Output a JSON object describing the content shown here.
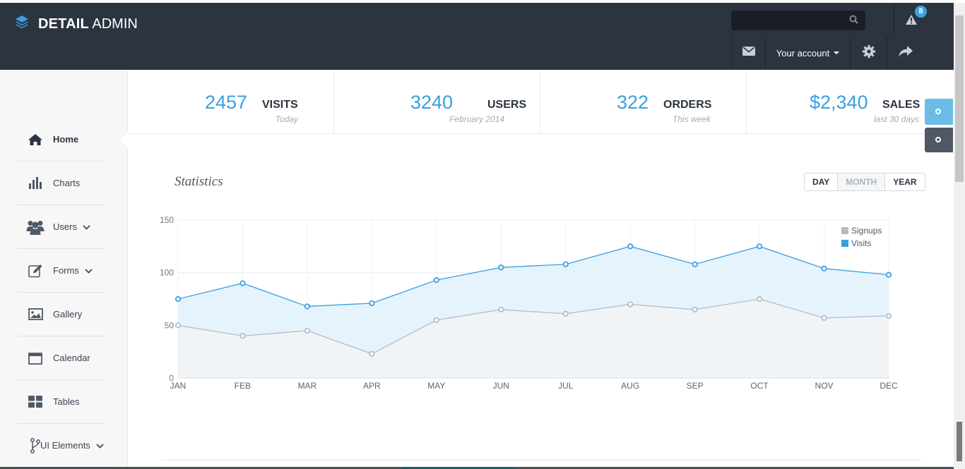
{
  "brand": {
    "bold": "DETAIL",
    "thin": "ADMIN"
  },
  "header": {
    "search_placeholder": "",
    "alert_count": "8",
    "account_label": "Your account"
  },
  "sidebar": {
    "items": [
      {
        "label": "Home",
        "icon": "home-icon",
        "active": true
      },
      {
        "label": "Charts",
        "icon": "bar-chart-icon"
      },
      {
        "label": "Users",
        "icon": "users-icon",
        "dropdown": true
      },
      {
        "label": "Forms",
        "icon": "edit-icon",
        "dropdown": true
      },
      {
        "label": "Gallery",
        "icon": "image-icon"
      },
      {
        "label": "Calendar",
        "icon": "calendar-icon"
      },
      {
        "label": "Tables",
        "icon": "grid-icon"
      },
      {
        "label": "UI Elements",
        "icon": "fork-icon",
        "dropdown": true
      }
    ]
  },
  "stats": [
    {
      "value": "2457",
      "name": "VISITS",
      "sub": "Today"
    },
    {
      "value": "3240",
      "name": "USERS",
      "sub": "February 2014"
    },
    {
      "value": "322",
      "name": "ORDERS",
      "sub": "This week"
    },
    {
      "value": "$2,340",
      "name": "SALES",
      "sub": "last 30 days"
    }
  ],
  "panel": {
    "title": "Statistics",
    "periods": [
      "DAY",
      "MONTH",
      "YEAR"
    ],
    "selected_period": "MONTH"
  },
  "chart_data": {
    "type": "area",
    "categories": [
      "JAN",
      "FEB",
      "MAR",
      "APR",
      "MAY",
      "JUN",
      "JUL",
      "AUG",
      "SEP",
      "OCT",
      "NOV",
      "DEC"
    ],
    "series": [
      {
        "name": "Signups",
        "color": "#b4bcc7",
        "values": [
          50,
          40,
          45,
          23,
          55,
          65,
          61,
          70,
          65,
          75,
          57,
          59
        ]
      },
      {
        "name": "Visits",
        "color": "#3a9fde",
        "values": [
          75,
          90,
          68,
          71,
          93,
          105,
          108,
          125,
          108,
          125,
          104,
          98
        ]
      }
    ],
    "yticks": [
      "0",
      "50",
      "100",
      "150"
    ],
    "ylim": [
      0,
      150
    ],
    "grid": true,
    "legend": "top-right"
  },
  "colors": {
    "accent": "#3aa0e0",
    "topbar": "#2c3440"
  }
}
